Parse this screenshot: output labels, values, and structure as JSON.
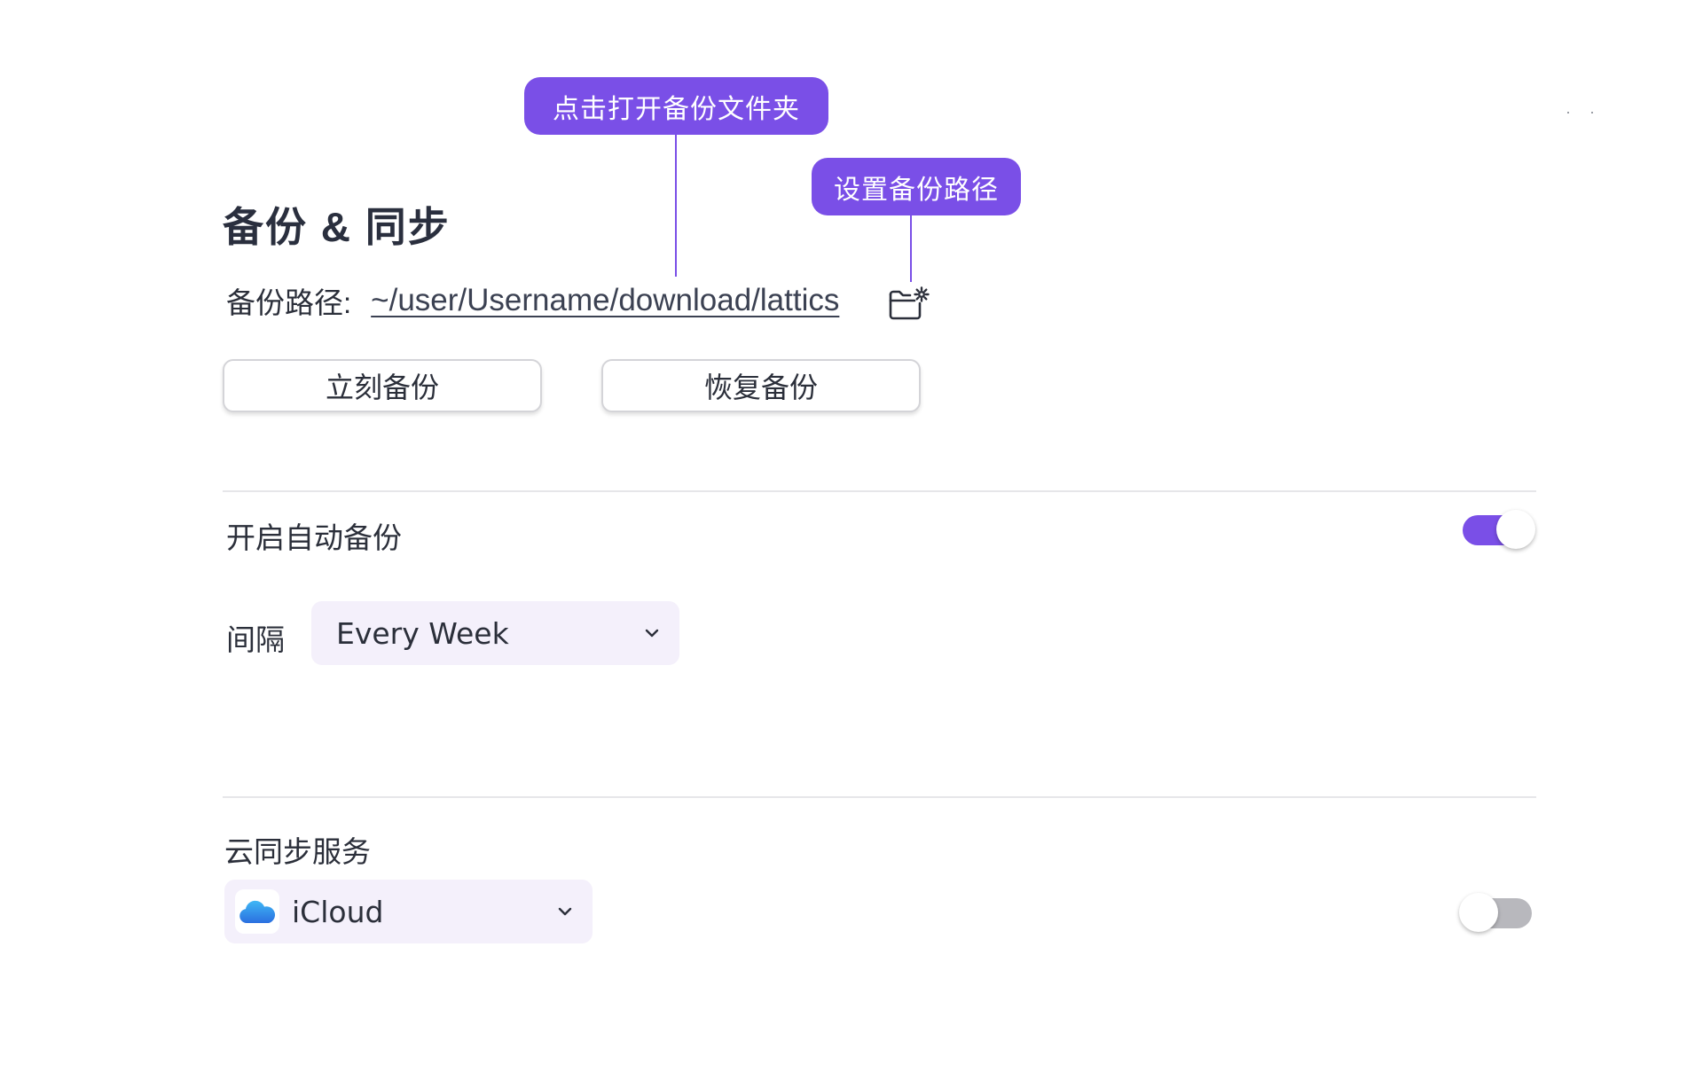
{
  "callouts": {
    "open_folder": "点击打开备份文件夹",
    "set_path": "设置备份路径"
  },
  "corner_dots": "· ·",
  "section": {
    "title": "备份 & 同步"
  },
  "backup_path": {
    "label": "备份路径:",
    "value": "~/user/Username/download/lattics",
    "settings_icon": "folder-settings-icon"
  },
  "buttons": {
    "backup_now": "立刻备份",
    "restore": "恢复备份"
  },
  "auto_backup": {
    "label": "开启自动备份",
    "enabled": true,
    "interval_label": "间隔",
    "interval_value": "Every Week"
  },
  "cloud_sync": {
    "label": "云同步服务",
    "service": "iCloud",
    "service_icon": "icloud-icon",
    "enabled": false
  },
  "colors": {
    "accent": "#7a4fe7",
    "select_bg": "#f4f0fb",
    "divider": "#e6e6e9",
    "toggle_off": "#b8b8bd"
  }
}
